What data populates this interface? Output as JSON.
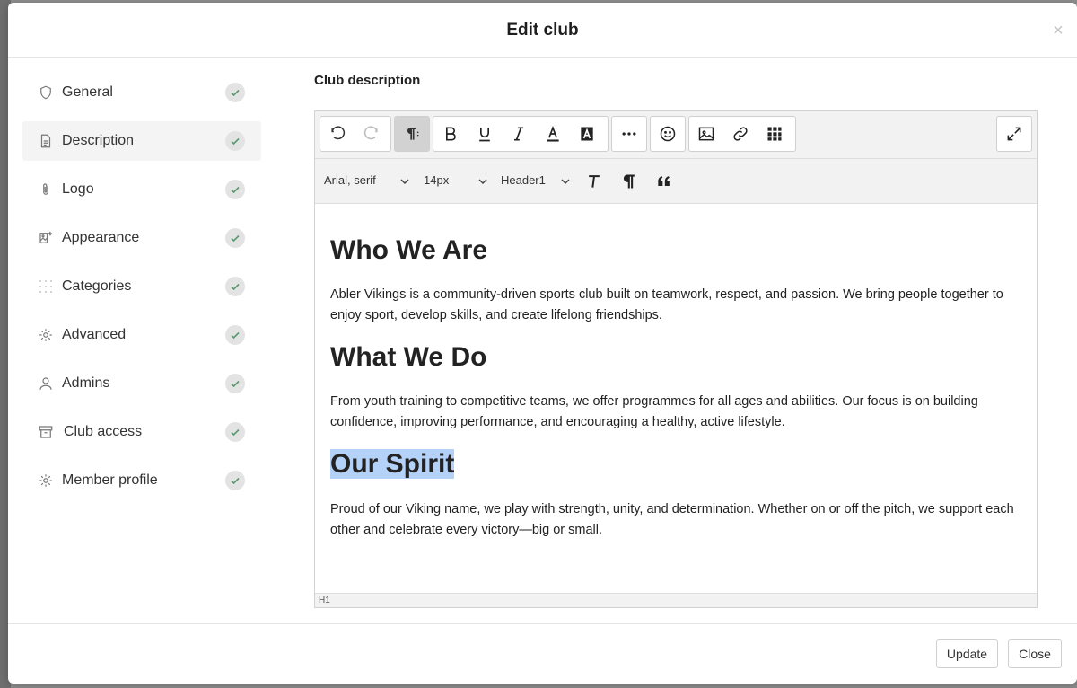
{
  "modal": {
    "title": "Edit club"
  },
  "sidebar": {
    "items": [
      {
        "label": "General",
        "icon": "shield-icon",
        "checked": true
      },
      {
        "label": "Description",
        "icon": "document-icon",
        "checked": true,
        "active": true
      },
      {
        "label": "Logo",
        "icon": "paperclip-icon",
        "checked": true
      },
      {
        "label": "Appearance",
        "icon": "image-edit-icon",
        "checked": true
      },
      {
        "label": "Categories",
        "icon": "grid-dots-icon",
        "checked": true
      },
      {
        "label": "Advanced",
        "icon": "gear-icon",
        "checked": true
      },
      {
        "label": "Admins",
        "icon": "user-icon",
        "checked": true
      },
      {
        "label": "Club access",
        "icon": "archive-icon",
        "checked": true
      },
      {
        "label": "Member profile",
        "icon": "gear-icon",
        "checked": true
      }
    ]
  },
  "content": {
    "section_label": "Club description"
  },
  "toolbar": {
    "font_family": "Arial, serif",
    "font_size": "14px",
    "block_format": "Header1"
  },
  "document": {
    "heading1": "Who We Are",
    "paragraph1": "Abler Vikings is a community-driven sports club built on teamwork, respect, and passion. We bring people together to enjoy sport, develop skills, and create lifelong friendships.",
    "heading2": "What We Do",
    "paragraph2": "From youth training to competitive teams, we offer programmes for all ages and abilities. Our focus is on building confidence, improving performance, and encouraging a healthy, active lifestyle.",
    "heading3": "Our Spirit",
    "paragraph3": "Proud of our Viking name, we play with strength, unity, and determination. Whether on or off the pitch, we support each other and celebrate every victory—big or small."
  },
  "statusbar": {
    "path": "H1"
  },
  "footer": {
    "update_label": "Update",
    "close_label": "Close"
  },
  "colors": {
    "check": "#5a9b6e",
    "highlight": "#b4d2f7",
    "active_nav": "#f4f4f4"
  }
}
